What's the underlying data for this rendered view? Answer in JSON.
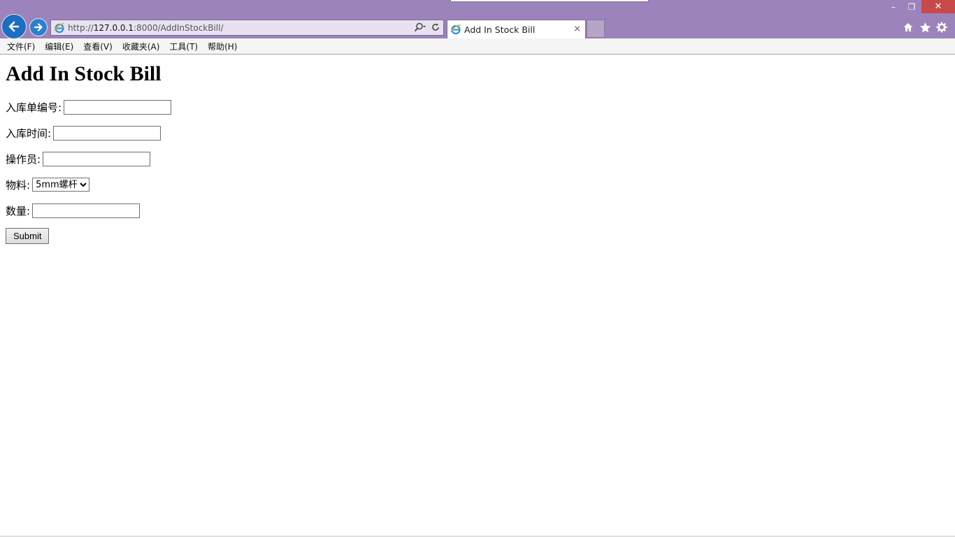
{
  "browser": {
    "url_scheme": "http://",
    "url_host": "127.0.0.1",
    "url_rest": ":8000/AddInStockBill/",
    "tab_title": "Add In Stock Bill",
    "tab_close": "×",
    "win_minimize": "–",
    "win_restore": "❐",
    "win_close": "✕"
  },
  "menu": {
    "items": [
      "文件(F)",
      "编辑(E)",
      "查看(V)",
      "收藏夹(A)",
      "工具(T)",
      "帮助(H)"
    ]
  },
  "page": {
    "title": "Add In Stock Bill",
    "fields": [
      {
        "label": "入库单编号:",
        "value": ""
      },
      {
        "label": "入库时间:",
        "value": ""
      },
      {
        "label": "操作员:",
        "value": ""
      },
      {
        "label": "物料:",
        "selected": "5mm螺杆"
      },
      {
        "label": "数量:",
        "value": ""
      }
    ],
    "submit_label": "Submit"
  },
  "colors": {
    "chrome": "#9d83bb",
    "close": "#c74949",
    "nav_blue": "#1c6ec2"
  }
}
